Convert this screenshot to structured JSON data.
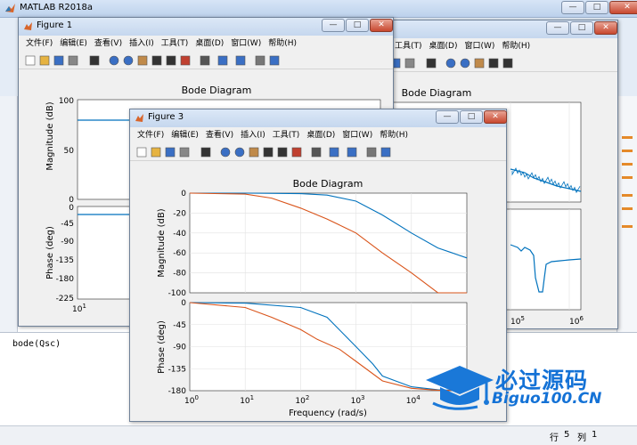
{
  "app": {
    "title": "MATLAB R2018a"
  },
  "command_window": {
    "line": "bode(Qsc)"
  },
  "status": {
    "row_label": "行",
    "row_value": "5",
    "col_label": "列",
    "col_value": "1"
  },
  "menu": [
    "文件(F)",
    "编辑(E)",
    "查看(V)",
    "插入(I)",
    "工具(T)",
    "桌面(D)",
    "窗口(W)",
    "帮助(H)"
  ],
  "menu_partial": [
    "工具(T)",
    "桌面(D)",
    "窗口(W)",
    "帮助(H)"
  ],
  "figure1": {
    "title": "Figure 1",
    "plot_title": "Bode Diagram",
    "mag_ylabel": "Magnitude (dB)",
    "phase_ylabel": "Phase (deg)",
    "mag_ticks": [
      "100",
      "50",
      "0"
    ],
    "phase_ticks": [
      "0",
      "-45",
      "-90",
      "-135",
      "-180",
      "-225"
    ],
    "x_tick": "10",
    "x_tick_exp": "1"
  },
  "figure2": {
    "plot_title": "Bode Diagram",
    "x_ticks": [
      {
        "base": "10",
        "exp": "5"
      },
      {
        "base": "10",
        "exp": "6"
      }
    ]
  },
  "figure3": {
    "title": "Figure 3",
    "plot_title": "Bode Diagram",
    "mag_ylabel": "Magnitude (dB)",
    "phase_ylabel": "Phase (deg)",
    "xlabel": "Frequency  (rad/s)",
    "mag_ticks": [
      "0",
      "-20",
      "-40",
      "-60",
      "-80",
      "-100"
    ],
    "phase_ticks": [
      "0",
      "-45",
      "-90",
      "-135",
      "-180"
    ],
    "x_ticks": [
      {
        "base": "10",
        "exp": "0"
      },
      {
        "base": "10",
        "exp": "1"
      },
      {
        "base": "10",
        "exp": "2"
      },
      {
        "base": "10",
        "exp": "3"
      },
      {
        "base": "10",
        "exp": "4"
      }
    ]
  },
  "watermark": {
    "line1": "必过源码",
    "line2": "Biguo100.CN"
  },
  "chart_data": [
    {
      "type": "line",
      "title": "Bode Diagram",
      "xlabel": "Frequency  (rad/s)",
      "ylabel": "Magnitude (dB)",
      "x_scale": "log",
      "xlim": [
        1,
        100000
      ],
      "ylim": [
        -100,
        0
      ],
      "grid": true,
      "series": [
        {
          "color": "#0072bd",
          "x": [
            1,
            10,
            100,
            300,
            1000,
            3000,
            10000,
            30000,
            100000
          ],
          "y": [
            0,
            0,
            -0.5,
            -2,
            -8,
            -22,
            -40,
            -55,
            -65
          ]
        },
        {
          "color": "#d95319",
          "x": [
            1,
            10,
            30,
            100,
            300,
            1000,
            3000,
            10000,
            30000,
            100000
          ],
          "y": [
            0,
            -1,
            -5,
            -15,
            -26,
            -40,
            -60,
            -80,
            -100,
            -100
          ]
        }
      ]
    },
    {
      "type": "line",
      "title": "",
      "xlabel": "Frequency  (rad/s)",
      "ylabel": "Phase (deg)",
      "x_scale": "log",
      "xlim": [
        1,
        100000
      ],
      "ylim": [
        -180,
        0
      ],
      "grid": true,
      "series": [
        {
          "color": "#0072bd",
          "x": [
            1,
            10,
            100,
            300,
            1000,
            2000,
            3000,
            10000,
            30000,
            100000
          ],
          "y": [
            0,
            -1,
            -10,
            -30,
            -90,
            -125,
            -150,
            -172,
            -178,
            -180
          ]
        },
        {
          "color": "#d95319",
          "x": [
            1,
            10,
            30,
            100,
            200,
            500,
            1000,
            3000,
            10000,
            30000,
            100000
          ],
          "y": [
            0,
            -10,
            -30,
            -55,
            -75,
            -95,
            -120,
            -160,
            -175,
            -179,
            -180
          ]
        }
      ]
    }
  ]
}
